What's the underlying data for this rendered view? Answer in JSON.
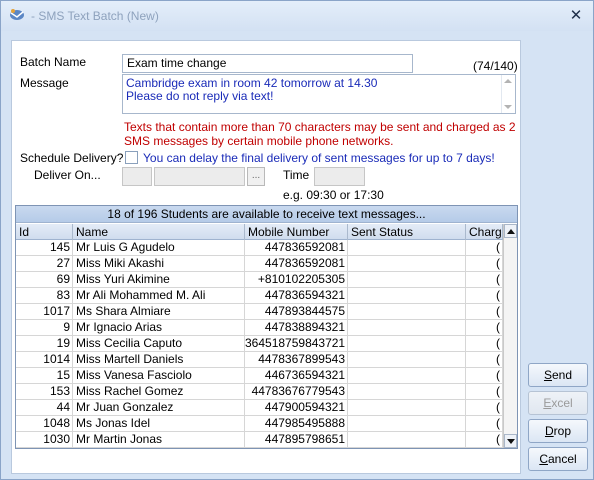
{
  "window": {
    "title": "- SMS Text Batch (New)",
    "close_glyph": "✕"
  },
  "form": {
    "batch_name_label": "Batch Name",
    "batch_name_value": "Exam time change",
    "char_count": "(74/140)",
    "message_label": "Message",
    "message_line1": "Cambridge exam in room 42 tomorrow at 14.30",
    "message_line2": "Please do not reply via text!",
    "warning_line1": "Texts that contain more than 70 characters may be sent and charged as 2",
    "warning_line2": "SMS messages by certain mobile phone networks.",
    "schedule_label": "Schedule Delivery?",
    "schedule_checked": false,
    "schedule_hint": "You can delay the final delivery of sent messages for up to 7 days!",
    "deliver_on_label": "Deliver On...",
    "ellipsis": "...",
    "time_label": "Time",
    "time_hint": "e.g. 09:30 or 17:30"
  },
  "grid": {
    "banner": "18 of 196 Students are available to receive text messages...",
    "columns": [
      "Id",
      "Name",
      "Mobile Number",
      "Sent Status",
      "Charg"
    ],
    "rows": [
      {
        "id": "145",
        "name": "Mr Luis G Agudelo",
        "mobile": "447836592081",
        "status": "",
        "charge": "("
      },
      {
        "id": "27",
        "name": "Miss Miki Akashi",
        "mobile": "447836592081",
        "status": "",
        "charge": "("
      },
      {
        "id": "69",
        "name": "Miss Yuri Akimine",
        "mobile": "+810102205305",
        "status": "",
        "charge": "("
      },
      {
        "id": "83",
        "name": "Mr Ali Mohammed M. Ali",
        "mobile": "447836594321",
        "status": "",
        "charge": "("
      },
      {
        "id": "1017",
        "name": "Ms Shara Almiare",
        "mobile": "447893844575",
        "status": "",
        "charge": "("
      },
      {
        "id": "9",
        "name": "Mr Ignacio Arias",
        "mobile": "447838894321",
        "status": "",
        "charge": "("
      },
      {
        "id": "19",
        "name": "Miss Cecilia Caputo",
        "mobile": "364518759843721",
        "status": "",
        "charge": "("
      },
      {
        "id": "1014",
        "name": "Miss Martell Daniels",
        "mobile": "4478367899543",
        "status": "",
        "charge": "("
      },
      {
        "id": "15",
        "name": "Miss Vanesa Fasciolo",
        "mobile": "446736594321",
        "status": "",
        "charge": "("
      },
      {
        "id": "153",
        "name": "Miss Rachel Gomez",
        "mobile": "44783676779543",
        "status": "",
        "charge": "("
      },
      {
        "id": "44",
        "name": "Mr Juan Gonzalez",
        "mobile": "447900594321",
        "status": "",
        "charge": "("
      },
      {
        "id": "1048",
        "name": "Ms Jonas Idel",
        "mobile": "447985495888",
        "status": "",
        "charge": "("
      },
      {
        "id": "1030",
        "name": "Mr Martin Jonas",
        "mobile": "447895798651",
        "status": "",
        "charge": "("
      }
    ]
  },
  "buttons": {
    "send": {
      "mnemonic": "S",
      "rest": "end"
    },
    "excel": {
      "mnemonic": "E",
      "rest": "xcel"
    },
    "drop": {
      "mnemonic": "D",
      "rest": "rop"
    },
    "cancel": {
      "mnemonic": "C",
      "rest": "ancel"
    }
  },
  "icons": {
    "app": "sms-app-icon",
    "close": "close-icon"
  },
  "colors": {
    "accent_blue": "#1a2bb8",
    "warning_red": "#c00000",
    "window_bg": "#d5e3f4"
  }
}
